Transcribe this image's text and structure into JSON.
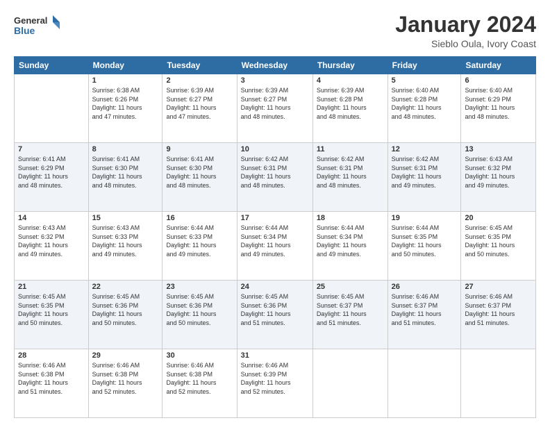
{
  "header": {
    "logo_line1": "General",
    "logo_line2": "Blue",
    "month": "January 2024",
    "location": "Sieblo Oula, Ivory Coast"
  },
  "days_of_week": [
    "Sunday",
    "Monday",
    "Tuesday",
    "Wednesday",
    "Thursday",
    "Friday",
    "Saturday"
  ],
  "weeks": [
    [
      {
        "num": "",
        "info": ""
      },
      {
        "num": "1",
        "info": "Sunrise: 6:38 AM\nSunset: 6:26 PM\nDaylight: 11 hours\nand 47 minutes."
      },
      {
        "num": "2",
        "info": "Sunrise: 6:39 AM\nSunset: 6:27 PM\nDaylight: 11 hours\nand 47 minutes."
      },
      {
        "num": "3",
        "info": "Sunrise: 6:39 AM\nSunset: 6:27 PM\nDaylight: 11 hours\nand 48 minutes."
      },
      {
        "num": "4",
        "info": "Sunrise: 6:39 AM\nSunset: 6:28 PM\nDaylight: 11 hours\nand 48 minutes."
      },
      {
        "num": "5",
        "info": "Sunrise: 6:40 AM\nSunset: 6:28 PM\nDaylight: 11 hours\nand 48 minutes."
      },
      {
        "num": "6",
        "info": "Sunrise: 6:40 AM\nSunset: 6:29 PM\nDaylight: 11 hours\nand 48 minutes."
      }
    ],
    [
      {
        "num": "7",
        "info": "Sunrise: 6:41 AM\nSunset: 6:29 PM\nDaylight: 11 hours\nand 48 minutes."
      },
      {
        "num": "8",
        "info": "Sunrise: 6:41 AM\nSunset: 6:30 PM\nDaylight: 11 hours\nand 48 minutes."
      },
      {
        "num": "9",
        "info": "Sunrise: 6:41 AM\nSunset: 6:30 PM\nDaylight: 11 hours\nand 48 minutes."
      },
      {
        "num": "10",
        "info": "Sunrise: 6:42 AM\nSunset: 6:31 PM\nDaylight: 11 hours\nand 48 minutes."
      },
      {
        "num": "11",
        "info": "Sunrise: 6:42 AM\nSunset: 6:31 PM\nDaylight: 11 hours\nand 48 minutes."
      },
      {
        "num": "12",
        "info": "Sunrise: 6:42 AM\nSunset: 6:31 PM\nDaylight: 11 hours\nand 49 minutes."
      },
      {
        "num": "13",
        "info": "Sunrise: 6:43 AM\nSunset: 6:32 PM\nDaylight: 11 hours\nand 49 minutes."
      }
    ],
    [
      {
        "num": "14",
        "info": "Sunrise: 6:43 AM\nSunset: 6:32 PM\nDaylight: 11 hours\nand 49 minutes."
      },
      {
        "num": "15",
        "info": "Sunrise: 6:43 AM\nSunset: 6:33 PM\nDaylight: 11 hours\nand 49 minutes."
      },
      {
        "num": "16",
        "info": "Sunrise: 6:44 AM\nSunset: 6:33 PM\nDaylight: 11 hours\nand 49 minutes."
      },
      {
        "num": "17",
        "info": "Sunrise: 6:44 AM\nSunset: 6:34 PM\nDaylight: 11 hours\nand 49 minutes."
      },
      {
        "num": "18",
        "info": "Sunrise: 6:44 AM\nSunset: 6:34 PM\nDaylight: 11 hours\nand 49 minutes."
      },
      {
        "num": "19",
        "info": "Sunrise: 6:44 AM\nSunset: 6:35 PM\nDaylight: 11 hours\nand 50 minutes."
      },
      {
        "num": "20",
        "info": "Sunrise: 6:45 AM\nSunset: 6:35 PM\nDaylight: 11 hours\nand 50 minutes."
      }
    ],
    [
      {
        "num": "21",
        "info": "Sunrise: 6:45 AM\nSunset: 6:35 PM\nDaylight: 11 hours\nand 50 minutes."
      },
      {
        "num": "22",
        "info": "Sunrise: 6:45 AM\nSunset: 6:36 PM\nDaylight: 11 hours\nand 50 minutes."
      },
      {
        "num": "23",
        "info": "Sunrise: 6:45 AM\nSunset: 6:36 PM\nDaylight: 11 hours\nand 50 minutes."
      },
      {
        "num": "24",
        "info": "Sunrise: 6:45 AM\nSunset: 6:36 PM\nDaylight: 11 hours\nand 51 minutes."
      },
      {
        "num": "25",
        "info": "Sunrise: 6:45 AM\nSunset: 6:37 PM\nDaylight: 11 hours\nand 51 minutes."
      },
      {
        "num": "26",
        "info": "Sunrise: 6:46 AM\nSunset: 6:37 PM\nDaylight: 11 hours\nand 51 minutes."
      },
      {
        "num": "27",
        "info": "Sunrise: 6:46 AM\nSunset: 6:37 PM\nDaylight: 11 hours\nand 51 minutes."
      }
    ],
    [
      {
        "num": "28",
        "info": "Sunrise: 6:46 AM\nSunset: 6:38 PM\nDaylight: 11 hours\nand 51 minutes."
      },
      {
        "num": "29",
        "info": "Sunrise: 6:46 AM\nSunset: 6:38 PM\nDaylight: 11 hours\nand 52 minutes."
      },
      {
        "num": "30",
        "info": "Sunrise: 6:46 AM\nSunset: 6:38 PM\nDaylight: 11 hours\nand 52 minutes."
      },
      {
        "num": "31",
        "info": "Sunrise: 6:46 AM\nSunset: 6:39 PM\nDaylight: 11 hours\nand 52 minutes."
      },
      {
        "num": "",
        "info": ""
      },
      {
        "num": "",
        "info": ""
      },
      {
        "num": "",
        "info": ""
      }
    ]
  ]
}
